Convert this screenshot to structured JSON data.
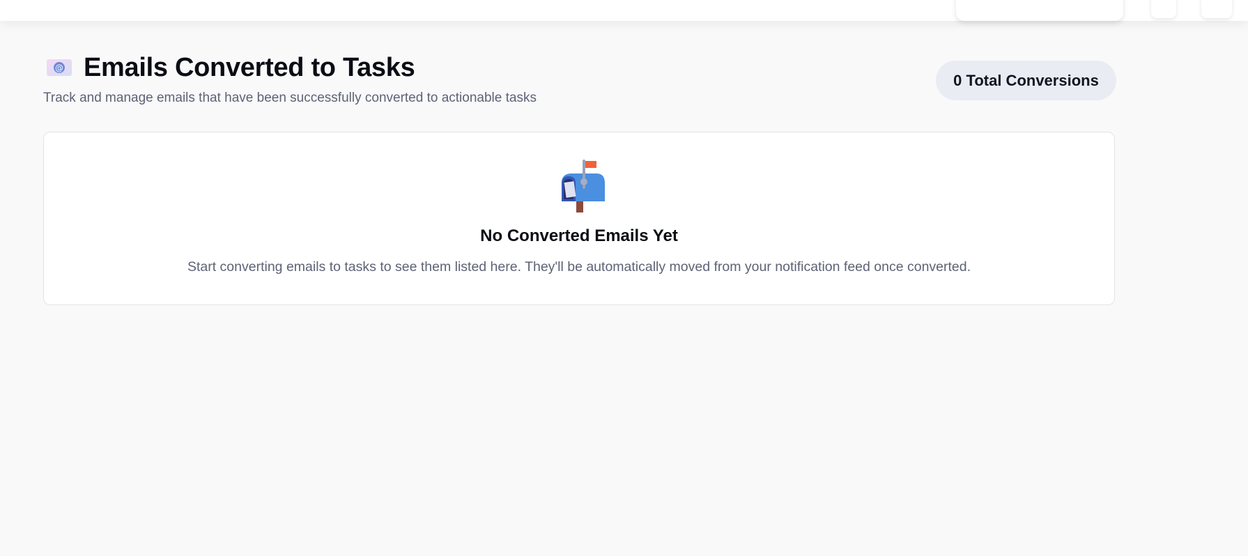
{
  "icons": {
    "title_icon": "envelope-with-at-icon",
    "empty_state_icon": "open-mailbox-with-raised-flag-icon"
  },
  "header": {
    "title": "Emails Converted to Tasks",
    "subtitle": "Track and manage emails that have been successfully converted to actionable tasks",
    "badge": "0 Total Conversions"
  },
  "empty_state": {
    "title": "No Converted Emails Yet",
    "message": "Start converting emails to tasks to see them listed here. They'll be automatically moved from your notification feed once converted."
  },
  "colors": {
    "background": "#f9f9fa",
    "badge_background": "#e9ecf3",
    "muted_text": "#5d6376",
    "title_text": "#0b0d14"
  }
}
